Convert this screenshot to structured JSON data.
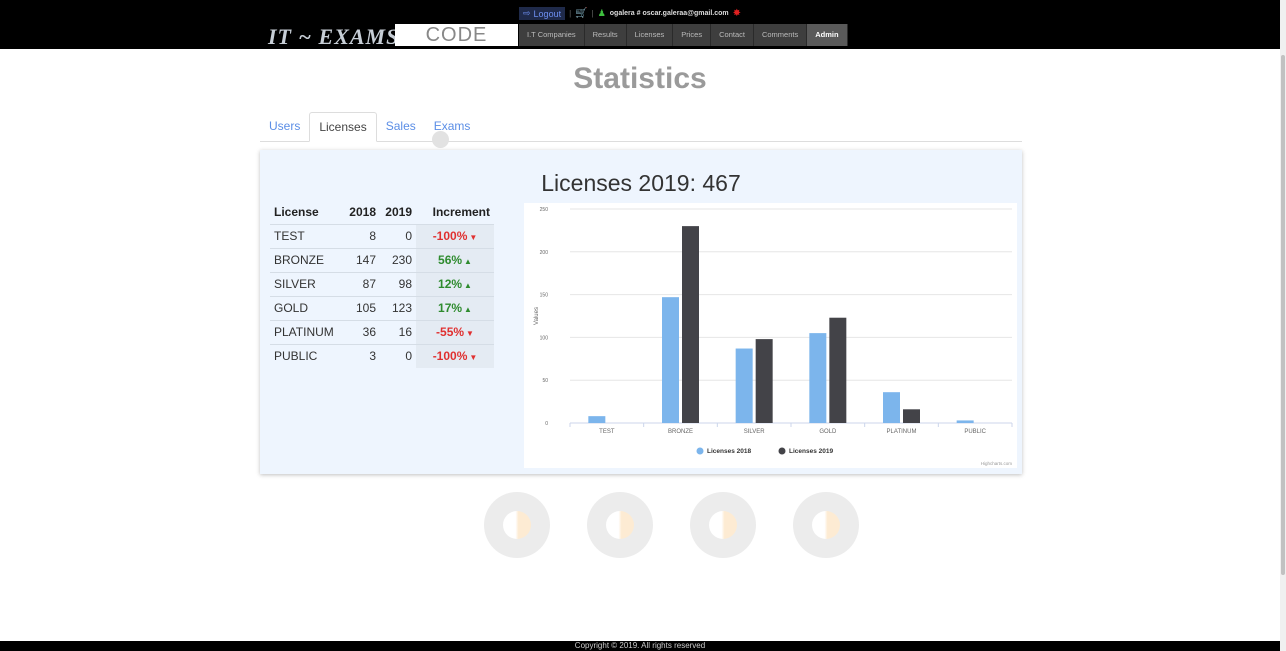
{
  "header": {
    "logo": "IT ~ EXAMS",
    "code_label": "CODE",
    "logout": "Logout",
    "user": "ogalera # oscar.galeraa@gmail.com",
    "nav": [
      "I.T Companies",
      "Results",
      "Licenses",
      "Prices",
      "Contact",
      "Comments",
      "Admin"
    ]
  },
  "page_title": "Statistics",
  "tabs": [
    "Users",
    "Licenses",
    "Sales",
    "Exams"
  ],
  "card_title": "Licenses 2019: 467",
  "table": {
    "headers": [
      "License",
      "2018",
      "2019",
      "Increment"
    ],
    "rows": [
      {
        "license": "TEST",
        "y2018": "8",
        "y2019": "0",
        "increment": "-100%",
        "trend": "down"
      },
      {
        "license": "BRONZE",
        "y2018": "147",
        "y2019": "230",
        "increment": "56%",
        "trend": "up"
      },
      {
        "license": "SILVER",
        "y2018": "87",
        "y2019": "98",
        "increment": "12%",
        "trend": "up"
      },
      {
        "license": "GOLD",
        "y2018": "105",
        "y2019": "123",
        "increment": "17%",
        "trend": "up"
      },
      {
        "license": "PLATINUM",
        "y2018": "36",
        "y2019": "16",
        "increment": "-55%",
        "trend": "down"
      },
      {
        "license": "PUBLIC",
        "y2018": "3",
        "y2019": "0",
        "increment": "-100%",
        "trend": "down"
      }
    ]
  },
  "chart_data": {
    "type": "bar",
    "categories": [
      "TEST",
      "BRONZE",
      "SILVER",
      "GOLD",
      "PLATINUM",
      "PUBLIC"
    ],
    "series": [
      {
        "name": "Licenses 2018",
        "values": [
          8,
          147,
          87,
          105,
          36,
          3
        ],
        "color": "#7cb5ec"
      },
      {
        "name": "Licenses 2019",
        "values": [
          0,
          230,
          98,
          123,
          16,
          0
        ],
        "color": "#434348"
      }
    ],
    "ylabel": "Values",
    "xlabel": "",
    "ylim": [
      0,
      250
    ],
    "yticks": [
      0,
      50,
      100,
      150,
      200,
      250
    ],
    "grid": true,
    "legend": "bottom-center",
    "credits": "Highcharts.com"
  },
  "footer": "Copyright © 2019. All rights reserved",
  "colors": {
    "up": "#2e8b2e",
    "down": "#e03030",
    "tab_link": "#5b8ee6"
  }
}
